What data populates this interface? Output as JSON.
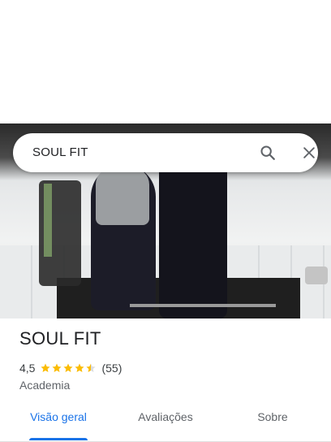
{
  "search": {
    "query": "SOUL FIT",
    "search_icon": "search-icon",
    "close_icon": "close-icon"
  },
  "hero": {
    "photo": "gym-mirror-photo"
  },
  "place": {
    "name": "SOUL FIT",
    "rating": "4,5",
    "rating_stars": 4.5,
    "review_count": "(55)",
    "category": "Academia"
  },
  "tabs": [
    {
      "label": "Visão geral",
      "active": true
    },
    {
      "label": "Avaliações",
      "active": false
    },
    {
      "label": "Sobre",
      "active": false
    }
  ],
  "colors": {
    "accent": "#1a73e8",
    "star": "#fbbc04",
    "text_primary": "#202124",
    "text_secondary": "#5f6368"
  }
}
